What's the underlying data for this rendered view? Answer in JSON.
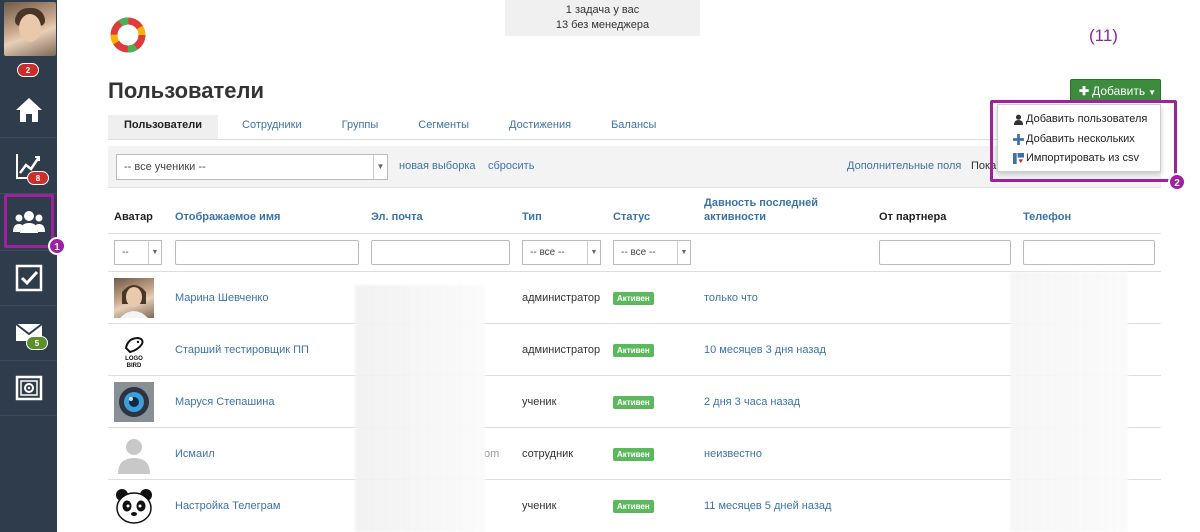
{
  "notice": {
    "line1": "1 задача у вас",
    "line2": "13 без менеджера"
  },
  "counter": "(11)",
  "page_title": "Пользователи",
  "add_button": {
    "label": "Добавить"
  },
  "dropdown": [
    {
      "label": "Добавить пользователя",
      "icon": "user-icon"
    },
    {
      "label": "Добавить нескольких",
      "icon": "plus-icon"
    },
    {
      "label": "Импортировать из csv",
      "icon": "import-icon"
    }
  ],
  "sidebar": {
    "badges": {
      "avatar": "2",
      "stats": "8",
      "mail": "5"
    },
    "annot1": "1",
    "annot2": "2"
  },
  "tabs": [
    "Пользователи",
    "Сотрудники",
    "Группы",
    "Сегменты",
    "Достижения",
    "Балансы"
  ],
  "filter": {
    "select_value": "-- все ученики --",
    "new_selection": "новая выборка",
    "reset": "сбросить",
    "extra_fields": "Дополнительные поля",
    "show": "Пока"
  },
  "columns": {
    "avatar": "Аватар",
    "name": "Отображаемое имя",
    "email": "Эл. почта",
    "type": "Тип",
    "status": "Статус",
    "activity_1": "Давность последней",
    "activity_2": "активности",
    "partner": "От партнера",
    "phone": "Телефон"
  },
  "col_filters": {
    "avatar": "--",
    "type": "-- все --",
    "status": "-- все --"
  },
  "rows": [
    {
      "name": "Марина Шевченко",
      "type": "администратор",
      "status": "Активен",
      "activity": "только что"
    },
    {
      "name": "Старший тестировщик ПП",
      "type": "администратор",
      "status": "Активен",
      "activity": "10 месяцев 3 дня назад"
    },
    {
      "name": "Маруся Степашина",
      "type": "ученик",
      "status": "Активен",
      "activity": "2 дня 3 часа назад"
    },
    {
      "name": "Исмаил",
      "email_tail": "om",
      "type": "сотрудник",
      "status": "Активен",
      "activity": "неизвестно"
    },
    {
      "name": "Настройка Телеграм",
      "type": "ученик",
      "status": "Активен",
      "activity": "11 месяцев 5 дней назад"
    }
  ],
  "logo_bird_text": "LOGO BIRD",
  "colors": {
    "sidebar": "#2e3c4c",
    "accent_link": "#3b73a8",
    "add_green": "#3d8b3d",
    "annotation": "#a020a0",
    "status_green": "#5cb85c"
  }
}
